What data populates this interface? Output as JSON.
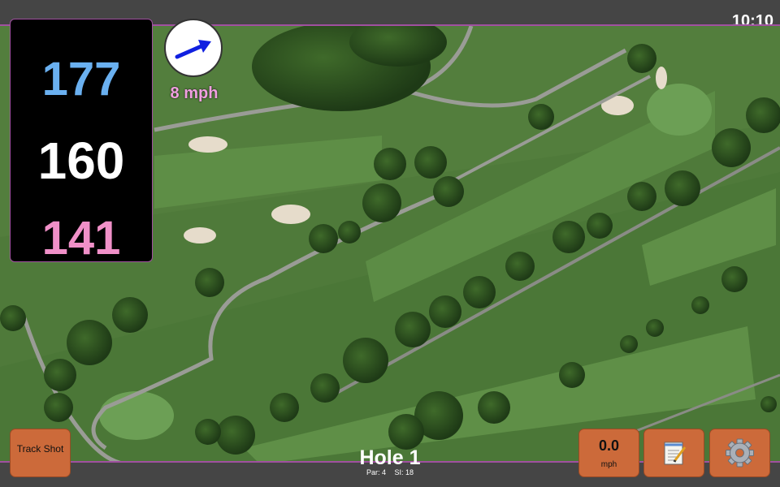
{
  "status": {
    "time": "10:10"
  },
  "distances": {
    "back": "177",
    "middle": "160",
    "front": "141"
  },
  "wind": {
    "speed_label": "8 mph",
    "arrow_icon": "wind-direction-arrow-icon"
  },
  "buttons": {
    "track_shot": "Track Shot",
    "wind_speed_value": "0.0",
    "wind_speed_unit": "mph",
    "notes_icon": "notepad-icon",
    "settings_icon": "gear-icon"
  },
  "hole": {
    "title": "Hole 1",
    "par": "Par: 4",
    "si": "SI: 18"
  },
  "colors": {
    "back": "#6ab0f0",
    "middle": "#ffffff",
    "front": "#f090c8",
    "button": "#cc6a3a",
    "accent": "#a050a0"
  }
}
